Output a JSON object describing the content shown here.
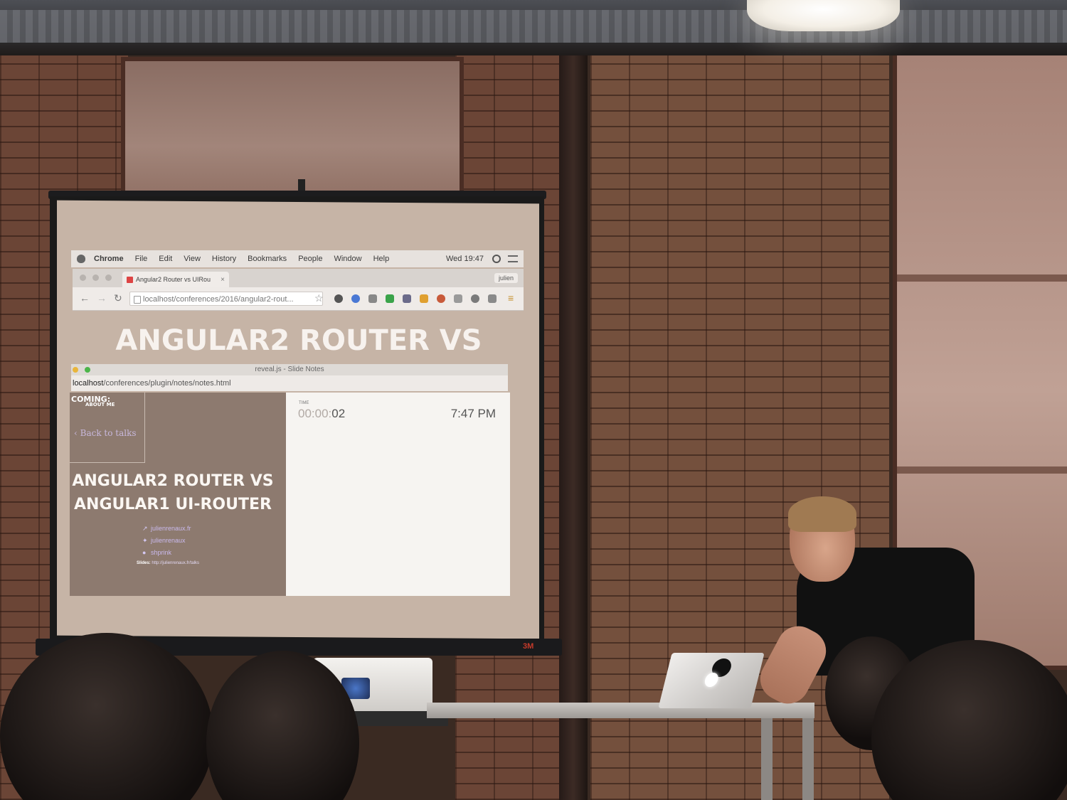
{
  "mac_menubar": {
    "items": [
      "Chrome",
      "File",
      "Edit",
      "View",
      "History",
      "Bookmarks",
      "People",
      "Window",
      "Help"
    ],
    "clock": "Wed 19:47"
  },
  "browser": {
    "tab_title": "Angular2 Router vs UIRou",
    "profile": "julien",
    "url": "localhost/conferences/2016/angular2-rout..."
  },
  "slide": {
    "title": "ANGULAR2 ROUTER VS"
  },
  "notes_window": {
    "title": "reveal.js - Slide Notes",
    "url_host": "localhost",
    "url_path": "/conferences/plugin/notes/notes.html",
    "current_slide": {
      "coming": "COMING:",
      "about_me": "ABOUT ME",
      "back_link": "Back to talks",
      "title_line1": "ANGULAR2 ROUTER VS",
      "title_line2": "ANGULAR1 UI-ROUTER",
      "links": [
        "julienrenaux.fr",
        "julienrenaux",
        "shprink"
      ],
      "slides_label": "Slides:",
      "slides_url": "http://julienrenaux.fr/talks"
    },
    "time_label": "TIME",
    "timer_muted": "00:00:",
    "timer_live": "02",
    "clock": "7:47 PM"
  },
  "screen_brand": "3M",
  "colors": {
    "slide_background": "#8d7a6f",
    "slide_text": "#f7f2ee",
    "link_text": "#c9b9ec"
  }
}
